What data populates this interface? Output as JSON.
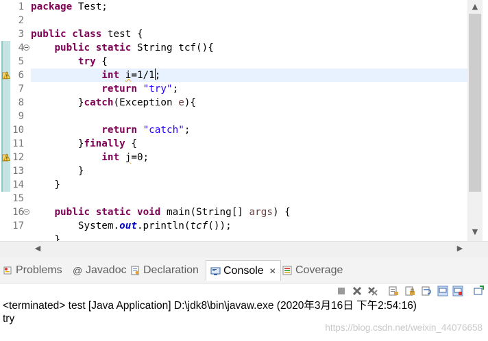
{
  "editor": {
    "line_numbers": [
      "1",
      "2",
      "3",
      "4",
      "5",
      "6",
      "7",
      "8",
      "9",
      "10",
      "11",
      "12",
      "13",
      "14",
      "15",
      "16",
      "17"
    ],
    "lines": [
      [
        {
          "t": "package",
          "c": "kw"
        },
        {
          "t": " Test;"
        }
      ],
      [],
      [
        {
          "t": "public",
          "c": "kw"
        },
        {
          "t": " "
        },
        {
          "t": "class",
          "c": "kw"
        },
        {
          "t": " test {"
        }
      ],
      [
        {
          "t": "    "
        },
        {
          "t": "public",
          "c": "kw"
        },
        {
          "t": " "
        },
        {
          "t": "static",
          "c": "kw"
        },
        {
          "t": " String tcf(){"
        }
      ],
      [
        {
          "t": "        "
        },
        {
          "t": "try",
          "c": "kw"
        },
        {
          "t": " {"
        }
      ],
      [
        {
          "t": "            "
        },
        {
          "t": "int",
          "c": "kw"
        },
        {
          "t": " "
        },
        {
          "t": "i",
          "c": "warnline"
        },
        {
          "t": "=1/1"
        },
        {
          "caret": true
        },
        {
          "t": ";"
        }
      ],
      [
        {
          "t": "            "
        },
        {
          "t": "return",
          "c": "kw"
        },
        {
          "t": " "
        },
        {
          "t": "\"try\"",
          "c": "str"
        },
        {
          "t": ";"
        }
      ],
      [
        {
          "t": "        }"
        },
        {
          "t": "catch",
          "c": "kw"
        },
        {
          "t": "(Exception "
        },
        {
          "t": "e",
          "c": "var"
        },
        {
          "t": "){"
        }
      ],
      [],
      [
        {
          "t": "            "
        },
        {
          "t": "return",
          "c": "kw"
        },
        {
          "t": " "
        },
        {
          "t": "\"catch\"",
          "c": "str"
        },
        {
          "t": ";"
        }
      ],
      [
        {
          "t": "        }"
        },
        {
          "t": "finally",
          "c": "kw"
        },
        {
          "t": " {"
        }
      ],
      [
        {
          "t": "            "
        },
        {
          "t": "int",
          "c": "kw"
        },
        {
          "t": " "
        },
        {
          "t": "j",
          "c": "warnline"
        },
        {
          "t": "=0;"
        }
      ],
      [
        {
          "t": "        }"
        }
      ],
      [
        {
          "t": "    }"
        }
      ],
      [],
      [
        {
          "t": "    "
        },
        {
          "t": "public",
          "c": "kw"
        },
        {
          "t": " "
        },
        {
          "t": "static",
          "c": "kw"
        },
        {
          "t": " "
        },
        {
          "t": "void",
          "c": "kw"
        },
        {
          "t": " main(String[] "
        },
        {
          "t": "args",
          "c": "var"
        },
        {
          "t": ") {"
        }
      ],
      [
        {
          "t": "        System."
        },
        {
          "t": "out",
          "c": "fld"
        },
        {
          "t": ".println("
        },
        {
          "t": "tcf",
          "c": "itl"
        },
        {
          "t": "());"
        }
      ],
      [
        {
          "t": "    }"
        }
      ]
    ]
  },
  "panel": {
    "tabs": [
      {
        "label": "Problems",
        "icon": "problems-icon",
        "active": false
      },
      {
        "label": "Javadoc",
        "icon": "javadoc-icon",
        "active": false
      },
      {
        "label": "Declaration",
        "icon": "declaration-icon",
        "active": false
      },
      {
        "label": "Console",
        "icon": "console-icon",
        "active": true,
        "close": "✕"
      },
      {
        "label": "Coverage",
        "icon": "coverage-icon",
        "active": false
      }
    ],
    "console": {
      "header": "<terminated> test [Java Application] D:\\jdk8\\bin\\javaw.exe (2020年3月16日 下午2:54:16)",
      "output": "try"
    },
    "watermark": "https://blog.csdn.net/weixin_44076658"
  }
}
